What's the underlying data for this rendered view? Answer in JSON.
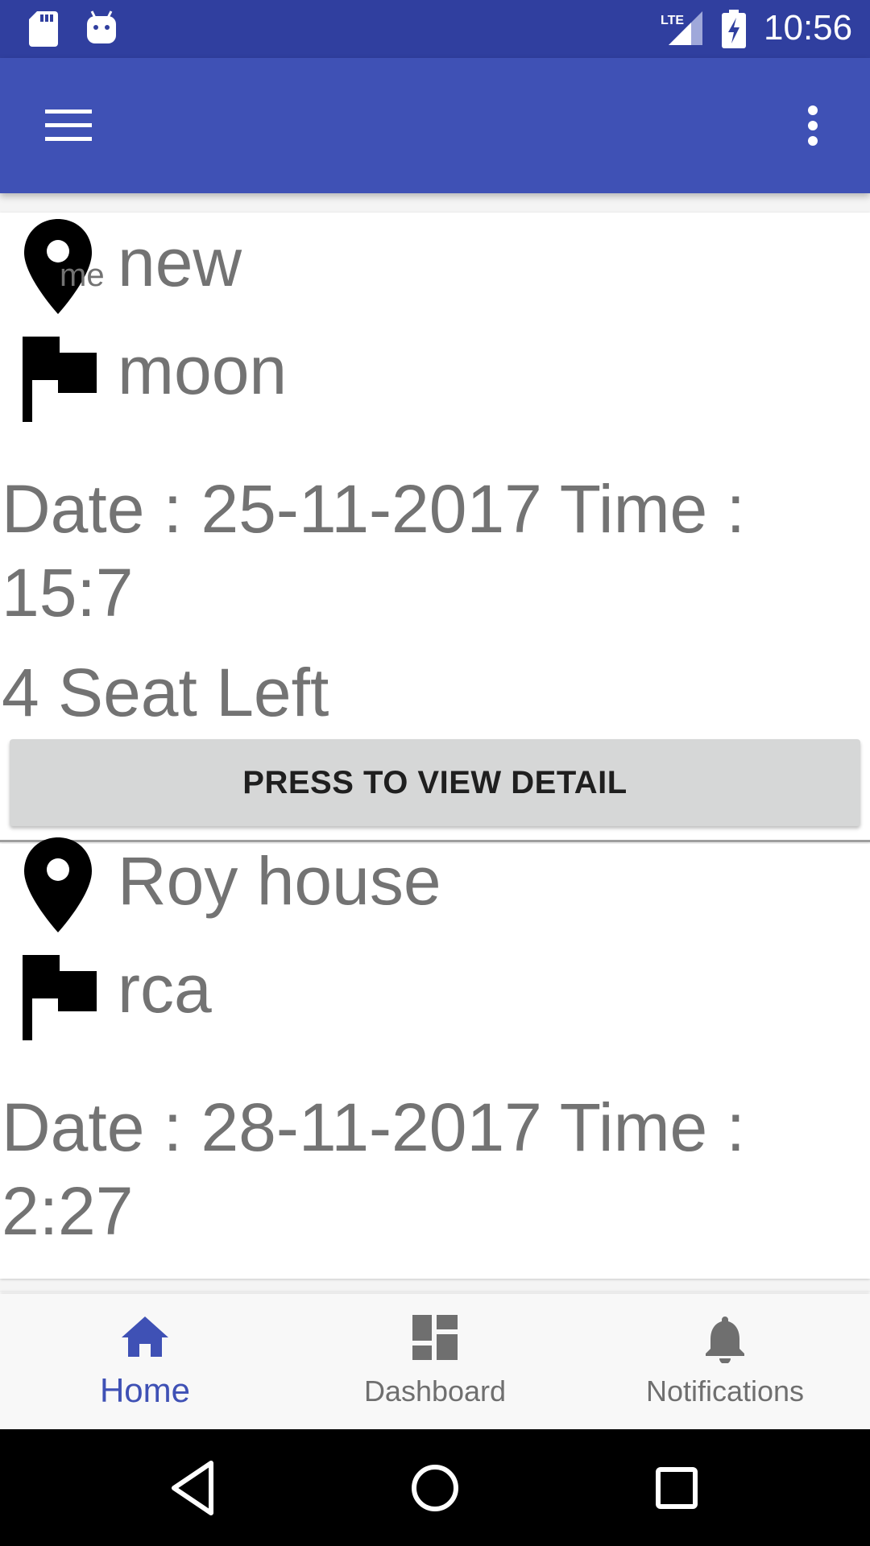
{
  "status_bar": {
    "time": "10:56",
    "icons": [
      "sd-card-icon",
      "android-icon",
      "lte-signal-icon",
      "battery-charging-icon"
    ],
    "network": "LTE"
  },
  "app_bar": {
    "menu_icon": "hamburger-menu-icon",
    "overflow_icon": "more-vert-icon",
    "color": "#3F51B5"
  },
  "rides": [
    {
      "origin": "new",
      "origin_hint": "me",
      "destination": "moon",
      "datetime": "Date : 25-11-2017 Time : 15:7",
      "seats": "4 Seat Left",
      "button_label": "PRESS TO VIEW DETAIL"
    },
    {
      "origin": "Roy house",
      "destination": "rca",
      "datetime": "Date : 28-11-2017 Time : 2:27"
    }
  ],
  "bottom_nav": {
    "items": [
      {
        "label": "Home",
        "icon": "home-icon",
        "active": true
      },
      {
        "label": "Dashboard",
        "icon": "dashboard-icon",
        "active": false
      },
      {
        "label": "Notifications",
        "icon": "bell-icon",
        "active": false
      }
    ],
    "active_color": "#3F51B5",
    "inactive_color": "#6f6f6f"
  },
  "system_nav": {
    "icons": [
      "back-icon",
      "home-circle-icon",
      "recents-icon"
    ]
  }
}
